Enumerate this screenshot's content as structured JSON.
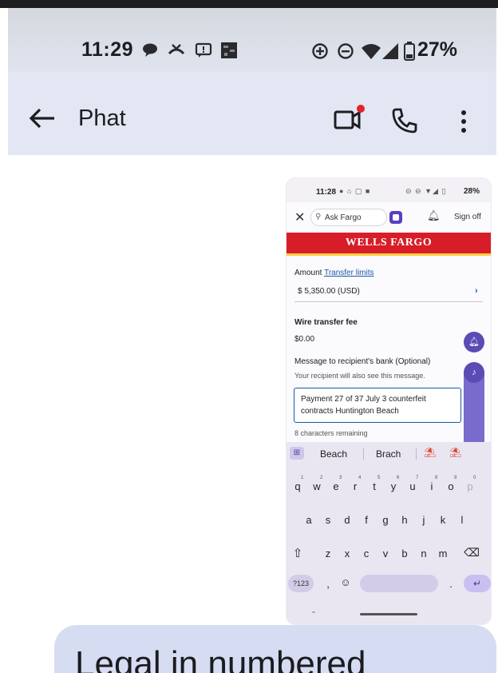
{
  "status_bar": {
    "time": "11:29",
    "battery": "27%"
  },
  "header": {
    "contact_name": "Phat"
  },
  "shared_screenshot": {
    "status": {
      "time": "11:28",
      "battery": "28%"
    },
    "toolbar": {
      "search_text": "Ask Fargo",
      "sign_off": "Sign off"
    },
    "bank_name": "WELLS FARGO",
    "form": {
      "amount_label": "Amount",
      "transfer_limits_link": "Transfer limits",
      "amount_value": "$ 5,350.00 (USD)",
      "wire_fee_label": "Wire transfer fee",
      "wire_fee_value": "$0.00",
      "message_label": "Message to recipient's bank (Optional)",
      "message_hint": "Your recipient will also see this message.",
      "message_value": "Payment 27 of 37 July 3 counterfeit contracts Huntington Beach",
      "chars_remaining": "8 characters remaining"
    },
    "keyboard": {
      "suggestions": [
        "Beach",
        "Brach"
      ],
      "row1": [
        "q",
        "w",
        "e",
        "r",
        "t",
        "y",
        "u",
        "i",
        "o",
        "p"
      ],
      "row1_hints": [
        "1",
        "2",
        "3",
        "4",
        "5",
        "6",
        "7",
        "8",
        "9",
        "0"
      ],
      "row2": [
        "a",
        "s",
        "d",
        "f",
        "g",
        "h",
        "j",
        "k",
        "l"
      ],
      "row3": [
        "z",
        "x",
        "c",
        "v",
        "b",
        "n",
        "m"
      ],
      "symbols_key": "?123",
      "comma_key": ",",
      "period_key": "."
    }
  },
  "message": {
    "text": "Legal in numbered"
  },
  "colors": {
    "bank_red": "#d71e28",
    "bank_gold": "#ffcd41",
    "accent_purple": "#5a4bb5",
    "bubble": "#d6dcf2"
  }
}
